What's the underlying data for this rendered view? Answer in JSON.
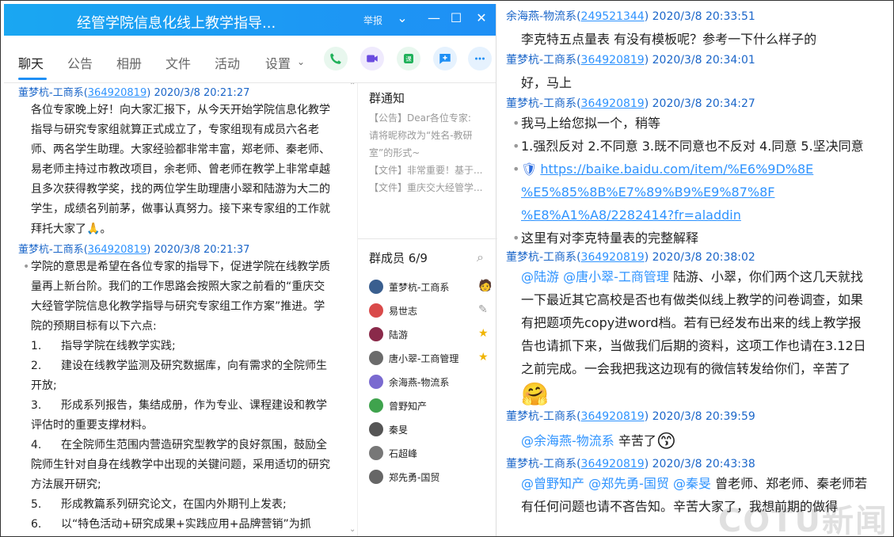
{
  "window": {
    "title": "经管学院信息化线上教学指导...",
    "report": "举报"
  },
  "tabs": [
    {
      "label": "聊天",
      "active": true
    },
    {
      "label": "公告"
    },
    {
      "label": "相册"
    },
    {
      "label": "文件"
    },
    {
      "label": "活动"
    },
    {
      "label": "设置"
    }
  ],
  "left_chat": [
    {
      "sender": "董梦杭-工商系",
      "qq": "364920819",
      "time": "2020/3/8 20:21:27",
      "lines": [
        "各位专家晚上好！向大家汇报下，从今天开始学院信息化教学",
        "指导与研究专家组就算正式成立了，专家组现有成员六名老",
        "师、两名学生助理。大家经验都非常丰富，郑老师、秦老师、",
        "易老师主持过市教改项目，余老师、曾老师在教学上非常卓越",
        "且多次获得教学奖，找的两位学生助理唐小翠和陆游为大二的",
        "学生，成绩名列前茅，做事认真努力。接下来专家组的工作就",
        "拜托大家了"
      ]
    },
    {
      "sender": "董梦杭-工商系",
      "qq": "364920819",
      "time": "2020/3/8 20:21:37",
      "lines": [
        "学院的意思是希望在各位专家的指导下，促进学院在线教学质",
        "量再上新台阶。我们的工作思路会按照大家之前看的“重庆交",
        "大经管学院信息化教学指导与研究专家组工作方案”推进。学",
        "院的预期目标有以下六点:"
      ],
      "numbered": [
        [
          "1.",
          "指导学院在线教学实践;"
        ],
        [
          "2.",
          "建设在线教学监测及研究数据库，向有需求的全院师生"
        ],
        [
          "",
          "开放;"
        ],
        [
          "3.",
          "形成系列报告，集结成册，作为专业、课程建设和教学"
        ],
        [
          "",
          "评估时的重要支撑材料。"
        ],
        [
          "4.",
          "在全院师生范围内营造研究型教学的良好氛围，鼓励全"
        ],
        [
          "",
          "院师生针对自身在线教学中出现的关键问题，采用适切的研究"
        ],
        [
          "",
          "方法展开研究;"
        ],
        [
          "5.",
          "形成教篇系列研究论文，在国内外期刊上发表;"
        ],
        [
          "6.",
          "以“特色活动+研究成果+实践应用+品牌营销”为抓"
        ]
      ]
    }
  ],
  "notice": {
    "title": "群通知",
    "lines": [
      "【公告】Dear各位专家:",
      "请将昵称改为“姓名-教研",
      "室”的形式~",
      "【文件】非常重要！基于...",
      "【文件】重庆交大经管学..."
    ]
  },
  "members": {
    "title": "群成员 6/9",
    "list": [
      {
        "name": "董梦杭-工商系",
        "color": "#3a5f8f",
        "tag": "owner"
      },
      {
        "name": "易世志",
        "color": "#d94a4a",
        "tag": "edit"
      },
      {
        "name": "陆游",
        "color": "#8a2a4a",
        "tag": "admin"
      },
      {
        "name": "唐小翠-工商管理",
        "color": "#6b6b6b",
        "tag": "admin"
      },
      {
        "name": "余海燕-物流系",
        "color": "#7a6ad0",
        "tag": ""
      },
      {
        "name": "曾野知产",
        "color": "#3fa34d",
        "tag": ""
      },
      {
        "name": "秦旻",
        "color": "#555555",
        "tag": ""
      },
      {
        "name": "石超峰",
        "color": "#777777",
        "tag": ""
      },
      {
        "name": "郑先勇-国贸",
        "color": "#666666",
        "tag": ""
      }
    ]
  },
  "right_chat": [
    {
      "sender": "余海燕-物流系",
      "qq": "249521344",
      "time": "2020/3/8 20:33:51",
      "items": [
        {
          "text": "李克特五点量表 有没有模板呢？参考一下什么样子的",
          "bullet": false
        }
      ]
    },
    {
      "sender": "董梦杭-工商系",
      "qq": "364920819",
      "time": "2020/3/8 20:34:01",
      "items": [
        {
          "text": "好，马上",
          "bullet": false
        }
      ]
    },
    {
      "sender": "董梦杭-工商系",
      "qq": "364920819",
      "time": "2020/3/8 20:34:27",
      "items": [
        {
          "text": "我马上给您拟一个，稍等",
          "bullet": true
        },
        {
          "text": "1.强烈反对 2.不同意 3.既不同意也不反对 4.同意 5.坚决同意",
          "bullet": true
        }
      ],
      "link": [
        "https://baike.baidu.com/item/%E6%9D%8E",
        "%E5%85%8B%E7%89%B9%E9%87%8F",
        "%E8%A1%A8/2282414?fr=aladdin"
      ],
      "after": "这里有对李克特量表的完整解释"
    },
    {
      "sender": "董梦杭-工商系",
      "qq": "364920819",
      "time": "2020/3/8 20:38:02",
      "mentions": [
        "@陆游",
        "@唐小翠-工商管理"
      ],
      "lines": [
        "陆游、小翠，你们两个这几天就找",
        "一下最近其它高校是否也有做类似线上教学的问卷调查，如果",
        "有把题项先copy进word档。若有已经发布出来的线上教学报",
        "告也请抓下来，当做我们后期的资料，这项工作也请在3.12日",
        "之前完成。一会我把我这边现有的微信转发给你们，辛苦了"
      ]
    },
    {
      "sender": "董梦杭-工商系",
      "qq": "364920819",
      "time": "2020/3/8 20:39:59",
      "mention": "@余海燕-物流系",
      "text": "辛苦了"
    },
    {
      "sender": "董梦杭-工商系",
      "qq": "364920819",
      "time": "2020/3/8 20:43:38",
      "mentions": [
        "@曾野知产",
        "@郑先勇-国贸",
        "@秦旻"
      ],
      "lines": [
        "曾老师、郑老师、秦老师若",
        "有任何问题也请不吝告知。辛苦大家了，我想前期的做得"
      ]
    }
  ],
  "watermark": "COTU新闻"
}
